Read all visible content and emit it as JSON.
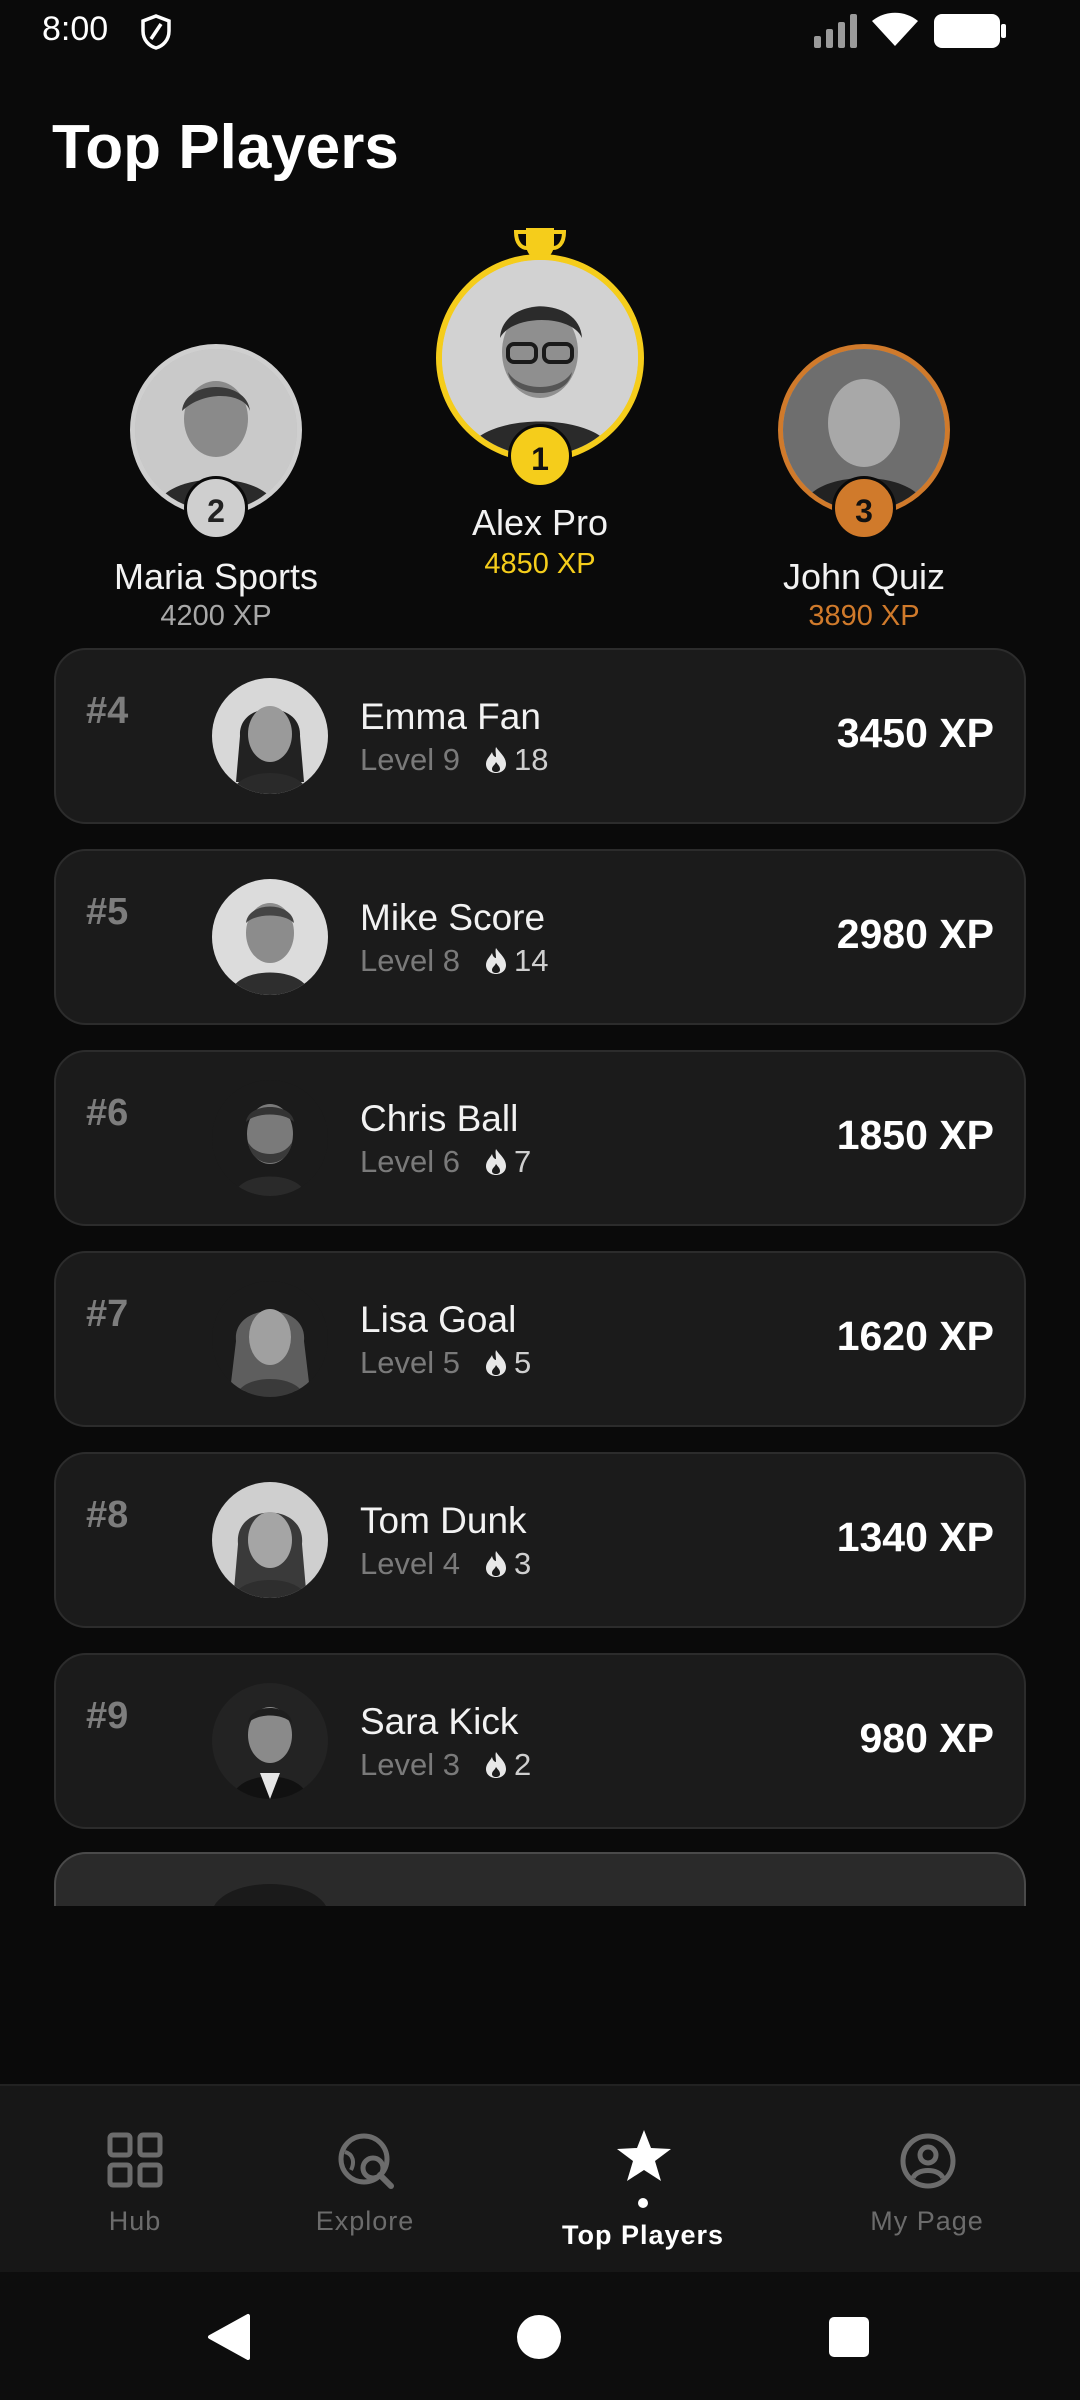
{
  "status_bar": {
    "time": "8:00"
  },
  "page_title": "Top Players",
  "podium": {
    "first": {
      "name": "Alex Pro",
      "xp": "4850 XP",
      "rank": "1"
    },
    "second": {
      "name": "Maria Sports",
      "xp": "4200 XP",
      "rank": "2"
    },
    "third": {
      "name": "John Quiz",
      "xp": "3890 XP",
      "rank": "3"
    }
  },
  "leaderboard": [
    {
      "rank": "#4",
      "name": "Emma Fan",
      "level": "Level 9",
      "streak": "18",
      "xp": "3450 XP"
    },
    {
      "rank": "#5",
      "name": "Mike Score",
      "level": "Level 8",
      "streak": "14",
      "xp": "2980 XP"
    },
    {
      "rank": "#6",
      "name": "Chris Ball",
      "level": "Level 6",
      "streak": "7",
      "xp": "1850 XP"
    },
    {
      "rank": "#7",
      "name": "Lisa Goal",
      "level": "Level 5",
      "streak": "5",
      "xp": "1620 XP"
    },
    {
      "rank": "#8",
      "name": "Tom Dunk",
      "level": "Level 4",
      "streak": "3",
      "xp": "1340 XP"
    },
    {
      "rank": "#9",
      "name": "Sara Kick",
      "level": "Level 3",
      "streak": "2",
      "xp": "980 XP"
    }
  ],
  "bottom_nav": {
    "items": [
      {
        "label": "Hub",
        "icon": "grid-icon",
        "active": false
      },
      {
        "label": "Explore",
        "icon": "globe-search-icon",
        "active": false
      },
      {
        "label": "Top Players",
        "icon": "star-icon",
        "active": true
      },
      {
        "label": "My Page",
        "icon": "user-circle-icon",
        "active": false
      }
    ]
  },
  "colors": {
    "gold": "#f5cd1b",
    "silver": "#cfcfcf",
    "bronze": "#d07a2b",
    "card_bg": "#1b1b1b",
    "background": "#0a0a0a"
  }
}
